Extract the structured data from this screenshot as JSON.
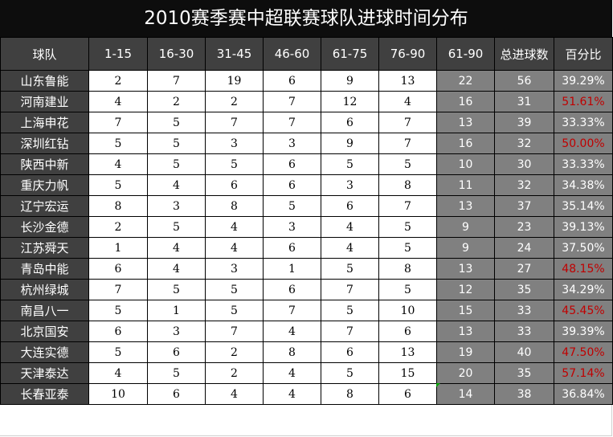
{
  "title": "2010赛季赛中超联赛球队进球时间分布",
  "columns": [
    "球队",
    "1-15",
    "16-30",
    "31-45",
    "46-60",
    "61-75",
    "76-90",
    "61-90",
    "总进球数",
    "百分比"
  ],
  "highlight_color": "#c00000",
  "rows": [
    {
      "team": "山东鲁能",
      "c1": "2",
      "c2": "7",
      "c3": "19",
      "c4": "6",
      "c5": "9",
      "c6": "13",
      "sum": "22",
      "total": "56",
      "pct": "39.29%",
      "hi": false
    },
    {
      "team": "河南建业",
      "c1": "4",
      "c2": "2",
      "c3": "2",
      "c4": "7",
      "c5": "12",
      "c6": "4",
      "sum": "16",
      "total": "31",
      "pct": "51.61%",
      "hi": true
    },
    {
      "team": "上海申花",
      "c1": "7",
      "c2": "5",
      "c3": "7",
      "c4": "7",
      "c5": "6",
      "c6": "7",
      "sum": "13",
      "total": "39",
      "pct": "33.33%",
      "hi": false
    },
    {
      "team": "深圳红钻",
      "c1": "5",
      "c2": "5",
      "c3": "3",
      "c4": "3",
      "c5": "9",
      "c6": "7",
      "sum": "16",
      "total": "32",
      "pct": "50.00%",
      "hi": true
    },
    {
      "team": "陕西中新",
      "c1": "4",
      "c2": "5",
      "c3": "5",
      "c4": "6",
      "c5": "5",
      "c6": "5",
      "sum": "10",
      "total": "30",
      "pct": "33.33%",
      "hi": false
    },
    {
      "team": "重庆力帆",
      "c1": "5",
      "c2": "4",
      "c3": "6",
      "c4": "6",
      "c5": "3",
      "c6": "8",
      "sum": "11",
      "total": "32",
      "pct": "34.38%",
      "hi": false
    },
    {
      "team": "辽宁宏运",
      "c1": "8",
      "c2": "3",
      "c3": "8",
      "c4": "5",
      "c5": "6",
      "c6": "7",
      "sum": "13",
      "total": "37",
      "pct": "35.14%",
      "hi": false
    },
    {
      "team": "长沙金德",
      "c1": "2",
      "c2": "5",
      "c3": "4",
      "c4": "3",
      "c5": "4",
      "c6": "5",
      "sum": "9",
      "total": "23",
      "pct": "39.13%",
      "hi": false
    },
    {
      "team": "江苏舜天",
      "c1": "1",
      "c2": "4",
      "c3": "4",
      "c4": "6",
      "c5": "4",
      "c6": "5",
      "sum": "9",
      "total": "24",
      "pct": "37.50%",
      "hi": false
    },
    {
      "team": "青岛中能",
      "c1": "6",
      "c2": "4",
      "c3": "3",
      "c4": "1",
      "c5": "5",
      "c6": "8",
      "sum": "13",
      "total": "27",
      "pct": "48.15%",
      "hi": true
    },
    {
      "team": "杭州绿城",
      "c1": "7",
      "c2": "5",
      "c3": "5",
      "c4": "6",
      "c5": "7",
      "c6": "5",
      "sum": "12",
      "total": "35",
      "pct": "34.29%",
      "hi": false
    },
    {
      "team": "南昌八一",
      "c1": "5",
      "c2": "1",
      "c3": "5",
      "c4": "7",
      "c5": "5",
      "c6": "10",
      "sum": "15",
      "total": "33",
      "pct": "45.45%",
      "hi": true
    },
    {
      "team": "北京国安",
      "c1": "6",
      "c2": "3",
      "c3": "7",
      "c4": "4",
      "c5": "7",
      "c6": "6",
      "sum": "13",
      "total": "33",
      "pct": "39.39%",
      "hi": false
    },
    {
      "team": "大连实德",
      "c1": "5",
      "c2": "6",
      "c3": "2",
      "c4": "8",
      "c5": "6",
      "c6": "13",
      "sum": "19",
      "total": "40",
      "pct": "47.50%",
      "hi": true
    },
    {
      "team": "天津泰达",
      "c1": "4",
      "c2": "5",
      "c3": "2",
      "c4": "4",
      "c5": "5",
      "c6": "15",
      "sum": "20",
      "total": "35",
      "pct": "57.14%",
      "hi": true
    },
    {
      "team": "长春亚泰",
      "c1": "10",
      "c2": "6",
      "c3": "4",
      "c4": "4",
      "c5": "8",
      "c6": "6",
      "sum": "14",
      "total": "38",
      "pct": "36.84%",
      "hi": false
    }
  ]
}
